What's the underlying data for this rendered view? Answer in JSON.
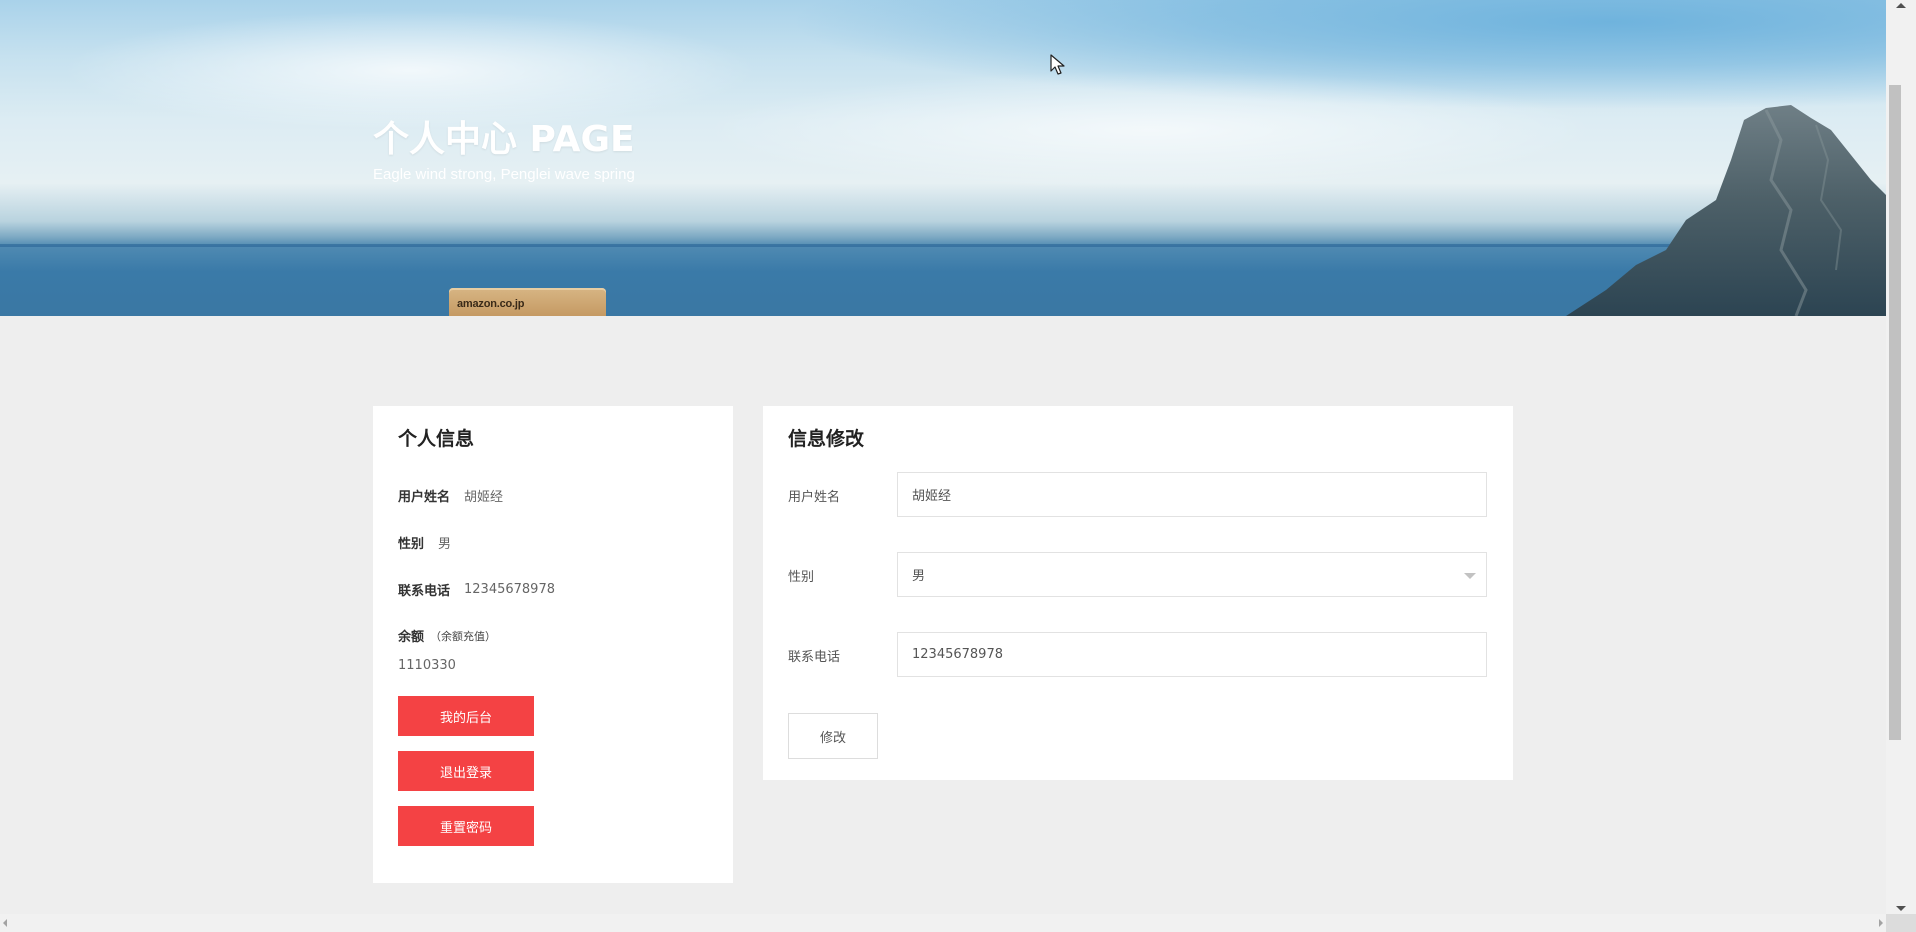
{
  "hero": {
    "title": "个人中心 PAGE",
    "subtitle": "Eagle wind strong, Penglei wave spring",
    "box_label": "amazon.co.jp"
  },
  "profile": {
    "title": "个人信息",
    "fields": {
      "username": {
        "label": "用户姓名",
        "value": "胡姬经"
      },
      "gender": {
        "label": "性别",
        "value": "男"
      },
      "phone": {
        "label": "联系电话",
        "value": "12345678978"
      },
      "balance": {
        "label": "余额",
        "hint": "（余额充值）",
        "value": "1110330"
      }
    },
    "buttons": {
      "dashboard": "我的后台",
      "logout": "退出登录",
      "reset_password": "重置密码"
    }
  },
  "edit_form": {
    "title": "信息修改",
    "username": {
      "label": "用户姓名",
      "value": "胡姬经"
    },
    "gender": {
      "label": "性别",
      "selected": "男"
    },
    "phone": {
      "label": "联系电话",
      "value": "12345678978"
    },
    "submit_label": "修改"
  },
  "colors": {
    "accent": "#f44244",
    "page_background": "#eeeeee",
    "card_background": "#ffffff"
  }
}
